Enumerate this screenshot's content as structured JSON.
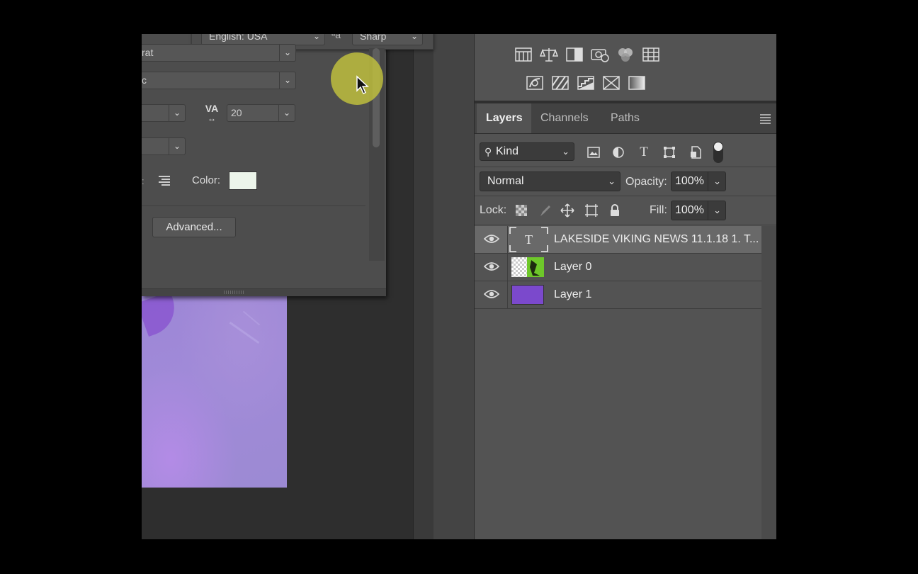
{
  "character_panel": {
    "language_value": "English: USA",
    "aa_icon": "aa-icon",
    "antialias_value": "Sharp",
    "font_family_value": "rat",
    "font_style_value": "c",
    "size_value": "",
    "tracking_value": "20",
    "scale_value": "",
    "color_label": "Color:",
    "color_swatch": "#ecf5ea",
    "advanced_button": "Advanced..."
  },
  "layers_panel": {
    "tabs": [
      {
        "label": "Layers",
        "active": true
      },
      {
        "label": "Channels",
        "active": false
      },
      {
        "label": "Paths",
        "active": false
      }
    ],
    "filter_kind": "Kind",
    "blend_mode": "Normal",
    "opacity_label": "Opacity:",
    "opacity_value": "100%",
    "lock_label": "Lock:",
    "fill_label": "Fill:",
    "fill_value": "100%",
    "layers": [
      {
        "name": "LAKESIDE VIKING NEWS  11.1.18 1. T...",
        "type": "text",
        "selected": true
      },
      {
        "name": "Layer 0",
        "type": "image",
        "selected": false
      },
      {
        "name": "Layer 1",
        "type": "fill",
        "color": "#7b49cc",
        "selected": false
      }
    ]
  },
  "adjustments": {
    "row1": [
      "levels-icon",
      "balance-icon",
      "bw-icon",
      "photo-filter-icon",
      "channel-mixer-icon",
      "color-lookup-icon"
    ],
    "row2": [
      "invert-icon",
      "posterize-icon",
      "threshold-icon",
      "selective-color-icon",
      "gradient-map-icon"
    ]
  },
  "canvas": {
    "artwork_color": "#a08ad8"
  }
}
